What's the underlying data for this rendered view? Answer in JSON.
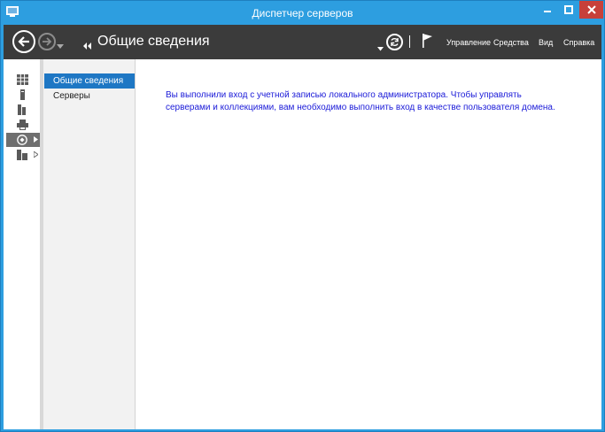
{
  "window": {
    "title": "Диспетчер серверов",
    "accent_color": "#2d9ee0",
    "close_color": "#c7403a"
  },
  "icons": {
    "app": "server-manager-icon",
    "back": "back-arrow-icon",
    "forward": "forward-arrow-icon",
    "refresh": "refresh-icon",
    "flag": "notifications-flag-icon"
  },
  "commandbar": {
    "breadcrumb_title": "Общие сведения",
    "menu": {
      "manage": "Управление",
      "tools": "Средства",
      "view": "Вид",
      "help": "Справка"
    }
  },
  "rail": {
    "items": [
      {
        "icon": "dashboard-icon"
      },
      {
        "icon": "local-server-icon"
      },
      {
        "icon": "all-servers-icon"
      },
      {
        "icon": "print-services-icon"
      },
      {
        "icon": "remote-desktop-services-icon",
        "active": true
      },
      {
        "icon": "file-storage-services-icon"
      }
    ]
  },
  "navigation": {
    "items": [
      {
        "label": "Общие сведения",
        "selected": true
      },
      {
        "label": "Серверы",
        "selected": false
      }
    ]
  },
  "content": {
    "message": "Вы выполнили вход с учетной записью локального администратора. Чтобы управлять серверами и коллекциями, вам необходимо выполнить вход в качестве пользователя домена."
  }
}
